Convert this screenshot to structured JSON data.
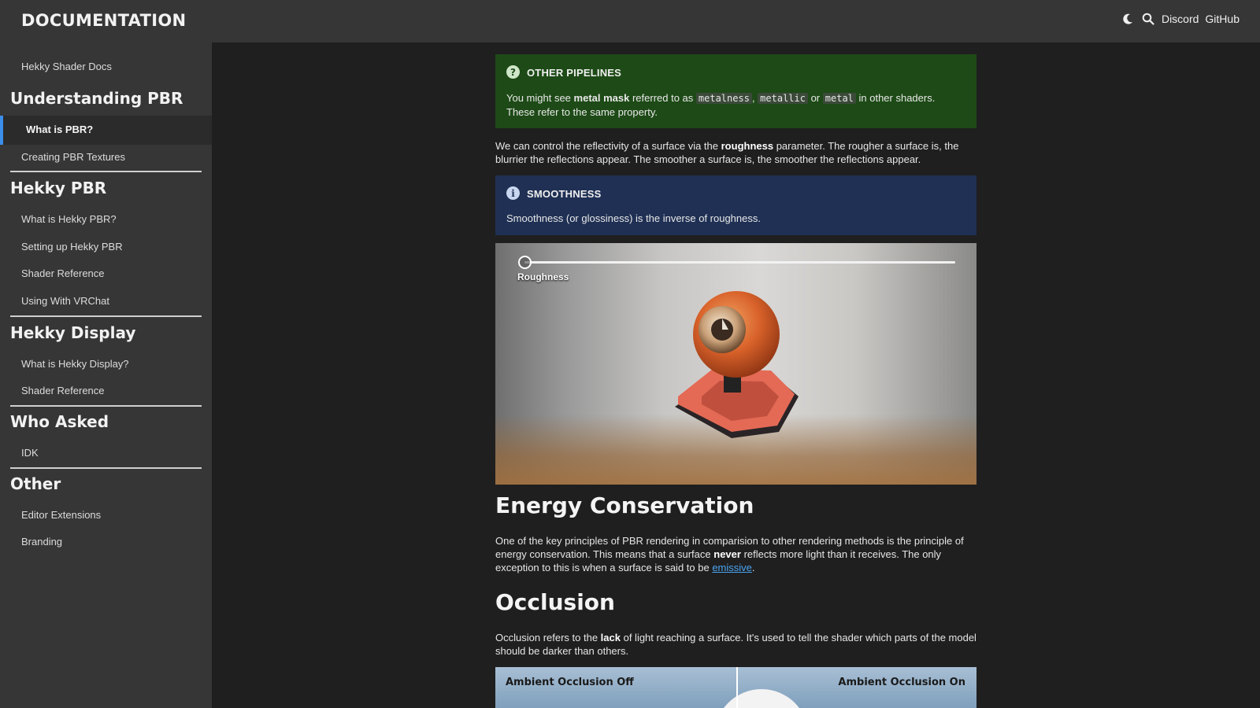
{
  "header": {
    "brand": "DOCUMENTATION",
    "links": [
      "Discord",
      "GitHub"
    ],
    "icons": [
      "moon-icon",
      "search-icon"
    ]
  },
  "sidebar": {
    "top_link": "Hekky Shader Docs",
    "sections": [
      {
        "title": "Understanding PBR",
        "items": [
          "What is PBR?",
          "Creating PBR Textures"
        ]
      },
      {
        "title": "Hekky PBR",
        "items": [
          "What is Hekky PBR?",
          "Setting up Hekky PBR",
          "Shader Reference",
          "Using With VRChat"
        ]
      },
      {
        "title": "Hekky Display",
        "items": [
          "What is Hekky Display?",
          "Shader Reference"
        ]
      },
      {
        "title": "Who Asked",
        "items": [
          "IDK"
        ]
      },
      {
        "title": "Other",
        "items": [
          "Editor Extensions",
          "Branding"
        ]
      }
    ],
    "active_item": "What is PBR?",
    "accent_color": "#3b8eea"
  },
  "main": {
    "callout_pipelines": {
      "title": "OTHER PIPELINES",
      "text_1": "You might see ",
      "bold": "metal mask",
      "text_2": " referred to as ",
      "code_1": "metalness",
      "sep_1": ", ",
      "code_2": "metallic",
      "sep_2": " or ",
      "code_3": "metal",
      "text_3": " in other shaders.",
      "line_2": "These refer to the same property.",
      "color": "#1d4a16"
    },
    "roughness_para": {
      "text_1": "We can control the reflectivity of a surface via the ",
      "bold": "roughness",
      "text_2": " parameter. The rougher a surface is, the blurrier the reflections appear. The smoother a surface is, the smoother the reflections appear."
    },
    "callout_smoothness": {
      "title": "SMOOTHNESS",
      "text": "Smoothness (or glossiness) is the inverse of roughness.",
      "color": "#1f3054"
    },
    "viewer": {
      "slider_label": "Roughness",
      "slider_value": 0
    },
    "energy": {
      "heading": "Energy Conservation",
      "text_1": "One of the key principles of PBR rendering in comparision to other rendering methods is the principle of energy conservation. This means that a surface ",
      "bold": "never",
      "text_2": " reflects more light than it receives. The only exception to this is when a surface is said to be ",
      "link": "emissive",
      "text_3": "."
    },
    "occlusion": {
      "heading": "Occlusion",
      "text_1": "Occlusion refers to the ",
      "bold": "lack",
      "text_2": " of light reaching a surface. It's used to tell the shader which parts of the model should be darker than others."
    },
    "ao_compare": {
      "left_label": "Ambient Occlusion Off",
      "right_label": "Ambient Occlusion On"
    }
  }
}
